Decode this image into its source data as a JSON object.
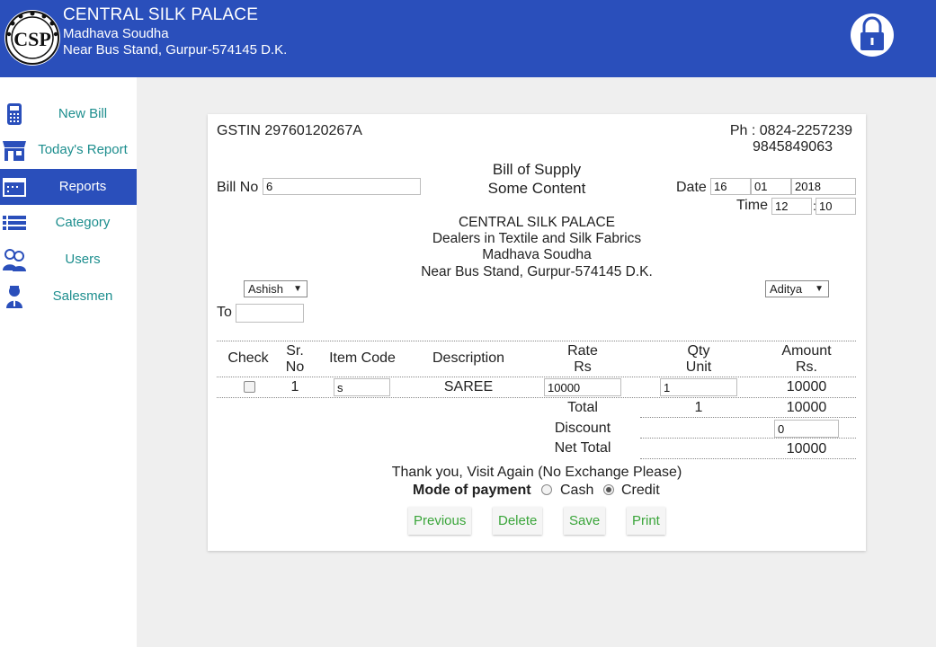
{
  "header": {
    "title": "CENTRAL SILK PALACE",
    "address1": "Madhava Soudha",
    "address2": "Near Bus Stand, Gurpur-574145 D.K.",
    "logo_text": "CSP",
    "logout_icon": "lock-icon"
  },
  "sidebar": {
    "items": [
      {
        "label": "New Bill",
        "icon": "calculator-icon"
      },
      {
        "label": "Today's Report",
        "icon": "store-icon"
      },
      {
        "label": "Reports",
        "icon": "calendar-icon",
        "active": true
      },
      {
        "label": "Category",
        "icon": "list-icon"
      },
      {
        "label": "Users",
        "icon": "users-icon"
      },
      {
        "label": "Salesmen",
        "icon": "salesman-icon"
      }
    ]
  },
  "bill": {
    "gstin": "GSTIN 29760120267A",
    "phone1": "Ph : 0824-2257239",
    "phone2": "9845849063",
    "heading1": "Bill of Supply",
    "heading2": "Some Content",
    "bill_no_label": "Bill No",
    "bill_no": "6",
    "date_label": "Date",
    "date_day": "16",
    "date_month": "01",
    "date_year": "2018",
    "time_label": "Time",
    "time_hour": "12",
    "time_sep": ":",
    "time_min": "10",
    "shop_name": "CENTRAL SILK PALACE",
    "shop_desc": "Dealers in Textile and Silk Fabrics",
    "shop_addr1": "Madhava Soudha",
    "shop_addr2": "Near Bus Stand, Gurpur-574145 D.K.",
    "user_select": "Ashish",
    "salesman_select": "Aditya",
    "to_label": "To",
    "to_value": ""
  },
  "table": {
    "headers": {
      "check": "Check",
      "srno_1": "Sr.",
      "srno_2": "No",
      "item_code": "Item Code",
      "description": "Description",
      "rate_1": "Rate",
      "rate_2": "Rs",
      "qty_1": "Qty",
      "qty_2": "Unit",
      "amount_1": "Amount",
      "amount_2": "Rs."
    },
    "rows": [
      {
        "sr": "1",
        "item_code": "s",
        "description": "SAREE",
        "rate": "10000",
        "qty": "1",
        "amount": "10000"
      }
    ],
    "total_label": "Total",
    "total_qty": "1",
    "total_amount": "10000",
    "discount_label": "Discount",
    "discount_value": "0",
    "net_total_label": "Net Total",
    "net_total": "10000"
  },
  "footer": {
    "thanks": "Thank you, Visit Again (No Exchange Please)",
    "payment_label": "Mode of payment",
    "cash_label": "Cash",
    "credit_label": "Credit",
    "selected_payment": "Credit"
  },
  "buttons": {
    "previous": "Previous",
    "delete": "Delete",
    "save": "Save",
    "print": "Print"
  },
  "colors": {
    "brand": "#2a4fbb",
    "nav_text": "#1d8e8e",
    "button_text": "#3aa53a"
  }
}
